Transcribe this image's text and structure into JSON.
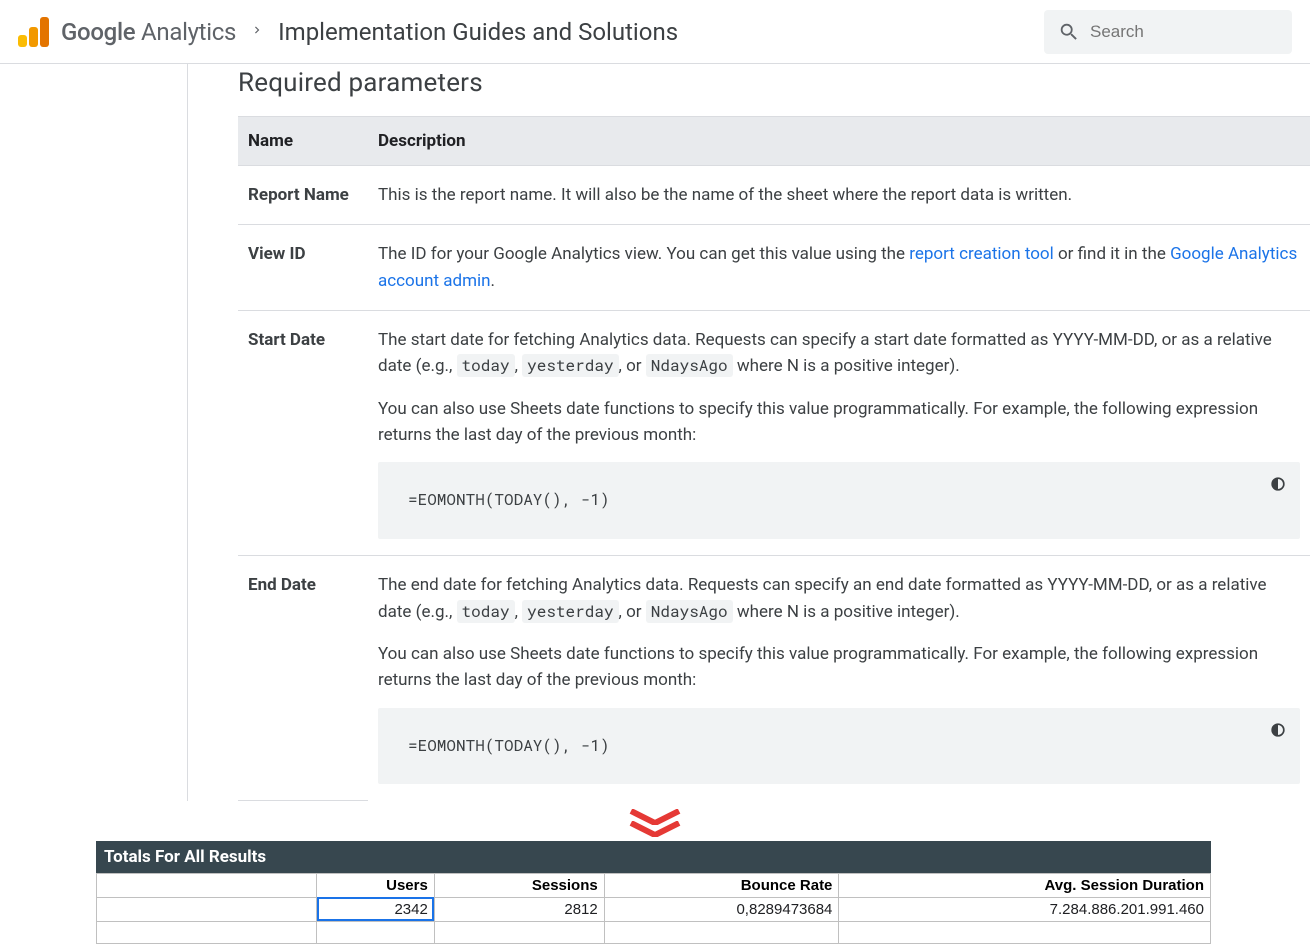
{
  "header": {
    "brand_prefix": "Google",
    "brand_suffix": " Analytics",
    "page_title": "Implementation Guides and Solutions",
    "search_placeholder": "Search"
  },
  "section": {
    "heading": "Required parameters",
    "col_name": "Name",
    "col_desc": "Description"
  },
  "rows": {
    "report_name": {
      "name": "Report Name",
      "desc": "This is the report name. It will also be the name of the sheet where the report data is written."
    },
    "view_id": {
      "name": "View ID",
      "pre": "The ID for your Google Analytics view. You can get this value using the ",
      "link1": "report creation tool",
      "mid": " or find it in the ",
      "link2": "Google Analytics account admin",
      "post": "."
    },
    "start_date": {
      "name": "Start Date",
      "d1a": "The start date for fetching Analytics data. Requests can specify a start date formatted as YYYY-MM-DD, or as a relative date (e.g., ",
      "c1": "today",
      "s1": ", ",
      "c2": "yesterday",
      "s2": ", or ",
      "c3": "NdaysAgo",
      "d1b": " where N is a positive integer).",
      "d2": "You can also use Sheets date functions to specify this value programmatically. For example, the following expression returns the last day of the previous month:",
      "code": "=EOMONTH(TODAY(), -1)"
    },
    "end_date": {
      "name": "End Date",
      "d1a": "The end date for fetching Analytics data. Requests can specify an end date formatted as YYYY-MM-DD, or as a relative date (e.g., ",
      "c1": "today",
      "s1": ", ",
      "c2": "yesterday",
      "s2": ", or ",
      "c3": "NdaysAgo",
      "d1b": " where N is a positive integer).",
      "d2": "You can also use Sheets date functions to specify this value programmatically. For example, the following expression returns the last day of the previous month:",
      "code": "=EOMONTH(TODAY(), -1)"
    }
  },
  "sheet": {
    "totals_label": "Totals For All Results",
    "headers": {
      "users": "Users",
      "sessions": "Sessions",
      "bounce": "Bounce Rate",
      "duration": "Avg. Session Duration"
    },
    "values": {
      "users": "2342",
      "sessions": "2812",
      "bounce": "0,8289473684",
      "duration": "7.284.886.201.991.460"
    }
  }
}
